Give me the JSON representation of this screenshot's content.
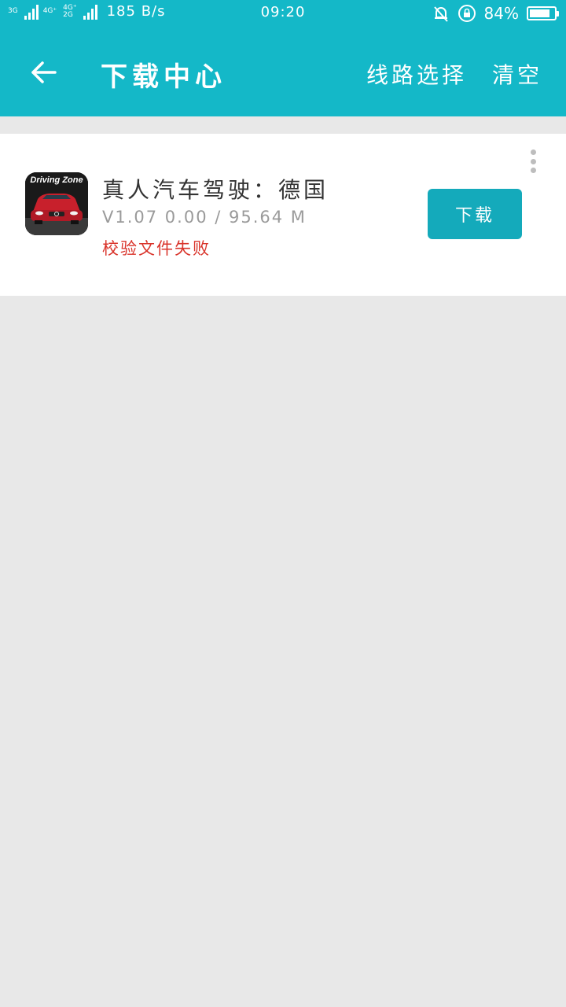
{
  "status_bar": {
    "net_labels": [
      "3G",
      "4G⁺",
      "4G⁺",
      "2G"
    ],
    "speed": "185 B/s",
    "time": "09:20",
    "battery_percent": "84%",
    "battery_level": 0.84,
    "icons": [
      "signal-icon",
      "mute-bell-icon",
      "rotation-lock-icon",
      "battery-icon"
    ]
  },
  "toolbar": {
    "back_icon": "arrow-left-icon",
    "title": "下载中心",
    "route_label": "线路选择",
    "clear_label": "清空"
  },
  "download_item": {
    "app_icon_text": "Driving Zone",
    "name": "真人汽车驾驶：德国",
    "meta": "V1.07 0.00 / 95.64 M",
    "status": "校验文件失败",
    "button_label": "下载",
    "more_icon": "more-vertical-icon"
  },
  "colors": {
    "header": "#14b8c8",
    "button": "#14aabb",
    "error": "#d9342b",
    "background": "#e8e8e8"
  }
}
